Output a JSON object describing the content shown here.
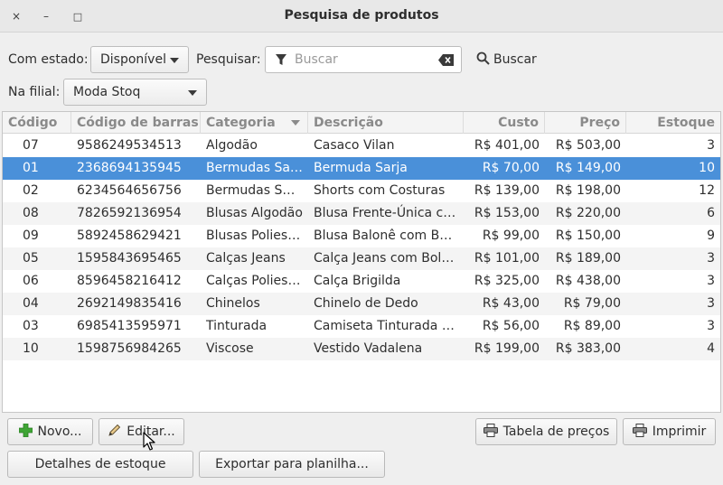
{
  "window": {
    "title": "Pesquisa de produtos",
    "close_glyph": "×",
    "minimize_glyph": "–",
    "maximize_glyph": "□"
  },
  "filters": {
    "state_label": "Com estado:",
    "state_value": "Disponível",
    "search_label": "Pesquisar:",
    "search_placeholder": "Buscar",
    "search_button": "Buscar",
    "branch_label": "Na filial:",
    "branch_value": "Moda Stoq"
  },
  "table": {
    "columns": [
      "Código",
      "Código de barras",
      "Categoria",
      "Descrição",
      "Custo",
      "Preço",
      "Estoque"
    ],
    "sorted_column": "Categoria",
    "selected_row": 1,
    "rows": [
      [
        "07",
        "9586249534513",
        "Algodão",
        "Casaco Vilan",
        "R$ 401,00",
        "R$ 503,00",
        "3"
      ],
      [
        "01",
        "2368694135945",
        "Bermudas Sarja",
        "Bermuda Sarja",
        "R$ 70,00",
        "R$ 149,00",
        "10"
      ],
      [
        "02",
        "6234564656756",
        "Bermudas Shorts",
        "Shorts com Costuras",
        "R$ 139,00",
        "R$ 198,00",
        "12"
      ],
      [
        "08",
        "7826592136954",
        "Blusas Algodão",
        "Blusa Frente-Única co…",
        "R$ 153,00",
        "R$ 220,00",
        "6"
      ],
      [
        "09",
        "5892458629421",
        "Blusas Poliester",
        "Blusa Balonê com Bo…",
        "R$ 99,00",
        "R$ 150,00",
        "9"
      ],
      [
        "05",
        "1595843695465",
        "Calças Jeans",
        "Calça Jeans com Bols…",
        "R$ 101,00",
        "R$ 189,00",
        "3"
      ],
      [
        "06",
        "8596458216412",
        "Calças Poliester",
        "Calça Brigilda",
        "R$ 325,00",
        "R$ 438,00",
        "3"
      ],
      [
        "04",
        "2692149835416",
        "Chinelos",
        "Chinelo de Dedo",
        "R$ 43,00",
        "R$ 79,00",
        "3"
      ],
      [
        "03",
        "6985413595971",
        "Tinturada",
        "Camiseta Tinturada X…",
        "R$ 56,00",
        "R$ 89,00",
        "3"
      ],
      [
        "10",
        "1598756984265",
        "Viscose",
        "Vestido Vadalena",
        "R$ 199,00",
        "R$ 383,00",
        "4"
      ]
    ]
  },
  "actions": {
    "new": "Novo...",
    "edit": "Editar...",
    "price_table": "Tabela de preços",
    "print": "Imprimir",
    "stock_details": "Detalhes de estoque",
    "export": "Exportar para planilha..."
  },
  "colors": {
    "selection": "#4a90d9",
    "accent_green": "#3fa535"
  }
}
